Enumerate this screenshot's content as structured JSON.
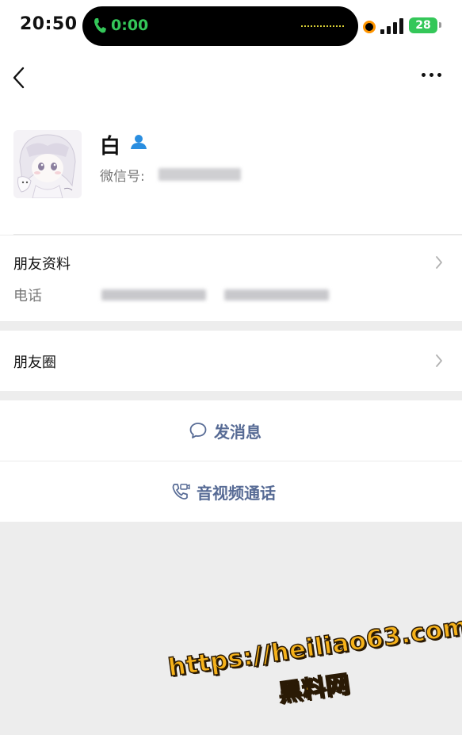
{
  "status_bar": {
    "time": "20:50",
    "call_timer": "0:00",
    "battery": "28",
    "accent_call": "#34c759",
    "accent_recording": "#ff9500"
  },
  "nav": {
    "back_icon": "chevron-left-icon",
    "more_icon": "more-dots-icon"
  },
  "profile": {
    "name": "白",
    "wechat_id_label": "微信号:",
    "badge_icon": "user-icon"
  },
  "friend_info": {
    "title": "朋友资料",
    "phone_label": "电话"
  },
  "moments": {
    "title": "朋友圈"
  },
  "actions": {
    "message_label": "发消息",
    "call_label": "音视频通话",
    "link_color": "#576b95"
  },
  "watermark": {
    "url": "https://heiliao63.com",
    "name": "黑料网"
  }
}
